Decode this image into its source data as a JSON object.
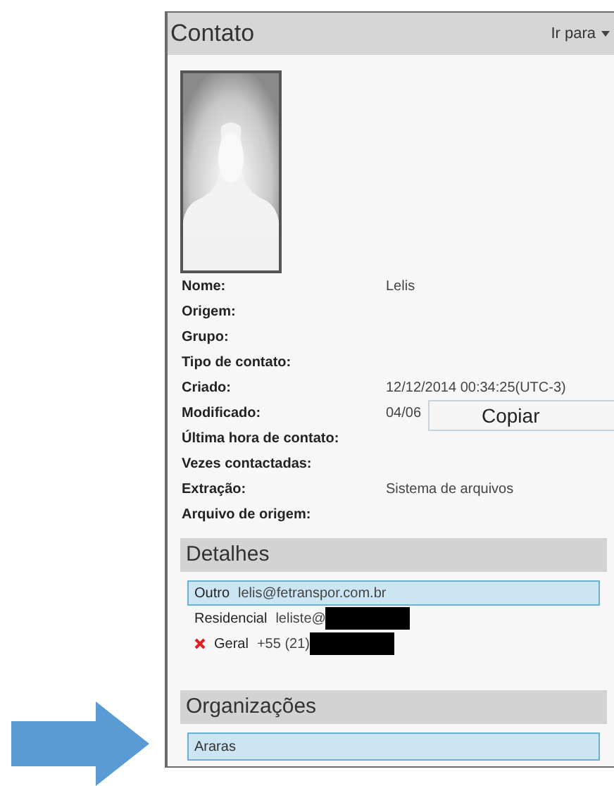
{
  "panel": {
    "title": "Contato",
    "goto_menu": "Ir para"
  },
  "fields": [
    {
      "label": "Nome:",
      "value": "Lelis"
    },
    {
      "label": "Origem:"
    },
    {
      "label": "Grupo:"
    },
    {
      "label": "Tipo de contato:"
    },
    {
      "label": "Criado:",
      "value": "12/12/2014 00:34:25(UTC-3)"
    },
    {
      "label": "Modificado:",
      "value": "04/06"
    },
    {
      "label": "Última hora de contato:"
    },
    {
      "label": "Vezes contactadas:"
    },
    {
      "label": "Extração:",
      "value": "Sistema de arquivos"
    },
    {
      "label": "Arquivo de origem:"
    }
  ],
  "tooltip": "Copiar",
  "details": {
    "title": "Detalhes",
    "entries": [
      {
        "type": "Outro",
        "value": "lelis@fetranspor.com.br",
        "selected": true,
        "redacted": false,
        "flagged": false
      },
      {
        "type": "Residencial",
        "value": "leliste@",
        "selected": false,
        "redacted": true,
        "flagged": false
      },
      {
        "type": "Geral",
        "value": "+55 (21)",
        "selected": false,
        "redacted": true,
        "flagged": true
      }
    ]
  },
  "organizations": {
    "title": "Organizações",
    "entries": [
      {
        "name": "Araras",
        "selected": true
      }
    ]
  }
}
